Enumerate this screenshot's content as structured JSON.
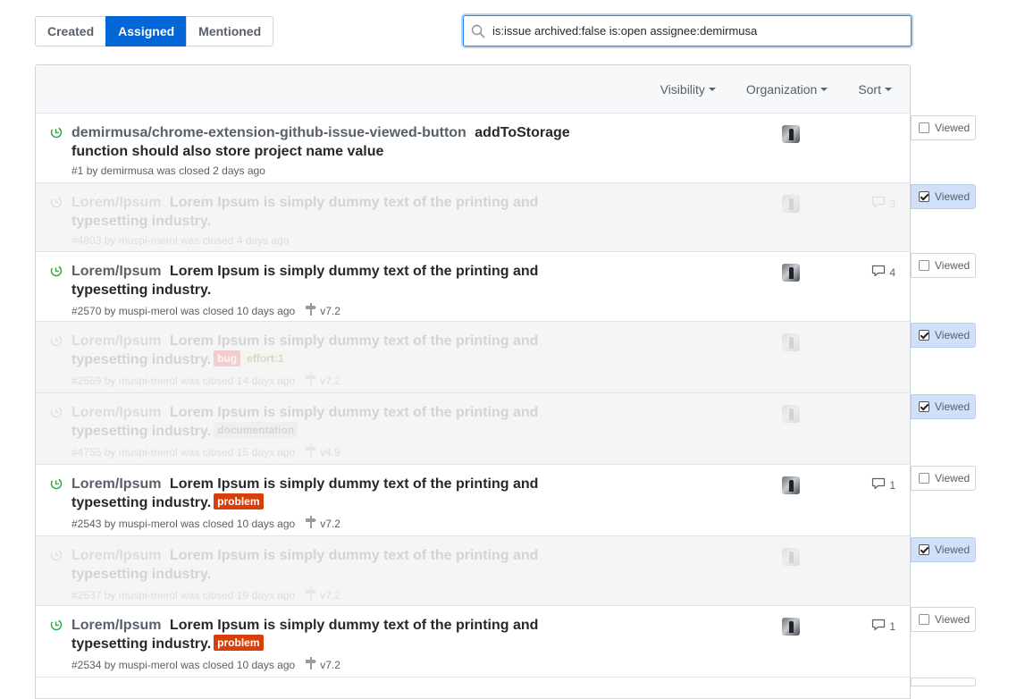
{
  "tabs": [
    {
      "label": "Created",
      "selected": false
    },
    {
      "label": "Assigned",
      "selected": true
    },
    {
      "label": "Mentioned",
      "selected": false
    }
  ],
  "search": {
    "value": "is:issue archived:false is:open assignee:demirmusa",
    "icon": "search-icon"
  },
  "filters": {
    "visibility": "Visibility",
    "organization": "Organization",
    "sort": "Sort"
  },
  "colors": {
    "accent": "#0366d6",
    "closed_icon": "#28a745",
    "viewed_bg": "#cfe0f8",
    "dim_row_bg": "#f5f5f5"
  },
  "viewed_label": "Viewed",
  "issues": [
    {
      "repo": "demirmusa/chrome-extension-github-issue-viewed-button",
      "title": "addToStorage function should also store project name value",
      "labels": [],
      "number": "#1",
      "by": "by",
      "author": "demirmusa",
      "status": "was closed 2 days ago",
      "milestone": "",
      "comments": "",
      "viewed": false
    },
    {
      "repo": "Lorem/Ipsum",
      "title": "Lorem Ipsum is simply dummy text of the printing and typesetting industry.",
      "labels": [],
      "number": "#4803",
      "by": "by",
      "author": "muspi-merol",
      "status": "was closed 4 days ago",
      "milestone": "",
      "comments": "3",
      "viewed": true
    },
    {
      "repo": "Lorem/Ipsum",
      "title": "Lorem Ipsum is simply dummy text of the printing and typesetting industry.",
      "labels": [],
      "number": "#2570",
      "by": "by",
      "author": "muspi-merol",
      "status": "was closed 10 days ago",
      "milestone": "v7.2",
      "comments": "4",
      "viewed": false
    },
    {
      "repo": "Lorem/Ipsum",
      "title": "Lorem Ipsum is simply dummy text of the printing and typesetting industry.",
      "labels": [
        {
          "text": "bug",
          "bg": "#ee0701",
          "fg": "#ffffff"
        },
        {
          "text": "effort:1",
          "bg": "#fef2c0",
          "fg": "#333333"
        }
      ],
      "number": "#2559",
      "by": "by",
      "author": "muspi-merol",
      "status": "was closed 14 days ago",
      "milestone": "v7.2",
      "comments": "",
      "viewed": true
    },
    {
      "repo": "Lorem/Ipsum",
      "title": "Lorem Ipsum is simply dummy text of the printing and typesetting industry.",
      "labels": [
        {
          "text": "documentation",
          "bg": "#bfdadc",
          "fg": "#333333"
        }
      ],
      "number": "#4755",
      "by": "by",
      "author": "muspi-merol",
      "status": "was closed 15 days ago",
      "milestone": "v4.9",
      "comments": "",
      "viewed": true
    },
    {
      "repo": "Lorem/Ipsum",
      "title": "Lorem Ipsum is simply dummy text of the printing and typesetting industry.",
      "labels": [
        {
          "text": "problem",
          "bg": "#d93f0b",
          "fg": "#ffffff"
        }
      ],
      "number": "#2543",
      "by": "by",
      "author": "muspi-merol",
      "status": "was closed 10 days ago",
      "milestone": "v7.2",
      "comments": "1",
      "viewed": false
    },
    {
      "repo": "Lorem/Ipsum",
      "title": "Lorem Ipsum is simply dummy text of the printing and typesetting industry.",
      "labels": [],
      "number": "#2537",
      "by": "by",
      "author": "muspi-merol",
      "status": "was closed 19 days ago",
      "milestone": "v7.2",
      "comments": "",
      "viewed": true
    },
    {
      "repo": "Lorem/Ipsum",
      "title": "Lorem Ipsum is simply dummy text of the printing and typesetting industry.",
      "labels": [
        {
          "text": "problem",
          "bg": "#d93f0b",
          "fg": "#ffffff"
        }
      ],
      "number": "#2534",
      "by": "by",
      "author": "muspi-merol",
      "status": "was closed 10 days ago",
      "milestone": "v7.2",
      "comments": "1",
      "viewed": false
    }
  ]
}
